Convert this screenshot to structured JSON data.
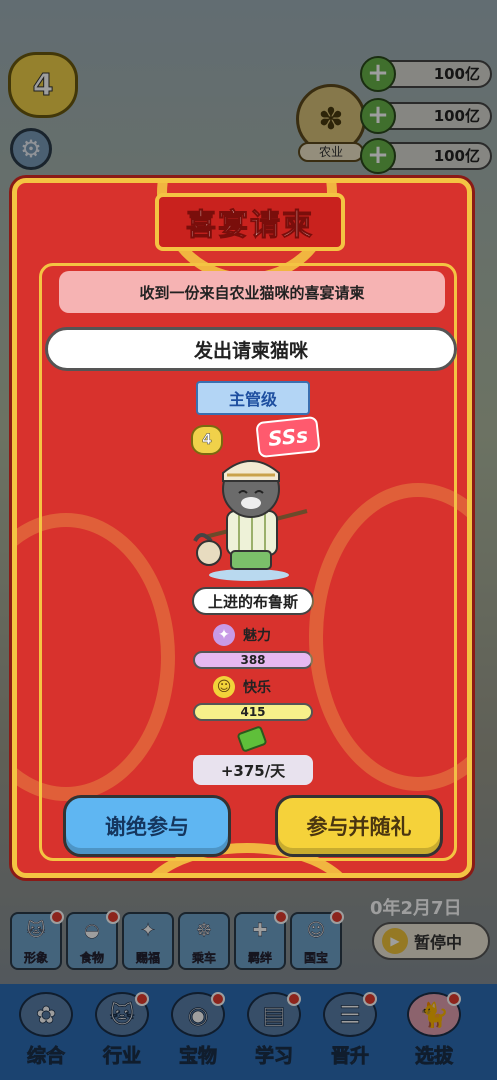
{
  "hud": {
    "player_level": "4",
    "resources": [
      {
        "value": "100亿"
      },
      {
        "value": "100亿"
      },
      {
        "value": "100亿"
      }
    ],
    "industry_label": "农业"
  },
  "modal": {
    "title": "喜宴请柬",
    "notice": "收到一份来自农业猫咪的喜宴请柬",
    "sender_label": "发出请柬猫咪",
    "rank": "主管级",
    "cat": {
      "level": "4",
      "grade": "SSs",
      "name": "上进的布鲁斯",
      "charm_label": "魅力",
      "charm_value": "388",
      "happy_label": "快乐",
      "happy_value": "415",
      "income": "+375/天"
    },
    "decline_button": "谢绝参与",
    "accept_button": "参与并随礼"
  },
  "game": {
    "date_text": "0年2月7日",
    "pause_label": "暂停中",
    "mini_actions": [
      {
        "label": "形象",
        "icon": "cat-face-icon"
      },
      {
        "label": "食物",
        "icon": "food-bowl-icon"
      },
      {
        "label": "赐福",
        "icon": "sparkle-icon"
      },
      {
        "label": "乘车",
        "icon": "wheel-icon"
      },
      {
        "label": "羁绊",
        "icon": "bone-icon"
      },
      {
        "label": "国宝",
        "icon": "lucky-cat-icon"
      }
    ]
  },
  "bottom_nav": [
    {
      "label": "综合",
      "icon": "paw-icon"
    },
    {
      "label": "行业",
      "icon": "cat-icon"
    },
    {
      "label": "宝物",
      "icon": "bell-icon"
    },
    {
      "label": "学习",
      "icon": "book-icon"
    },
    {
      "label": "晋升",
      "icon": "scroll-icon"
    },
    {
      "label": "选拔",
      "icon": "cat-cushion-icon"
    }
  ],
  "colors": {
    "modal_red": "#d8322d",
    "gold_border": "#f4c443",
    "decline_blue": "#5fb6f2",
    "accept_yellow": "#f5d23a",
    "nav_blue": "#2c6db5"
  }
}
